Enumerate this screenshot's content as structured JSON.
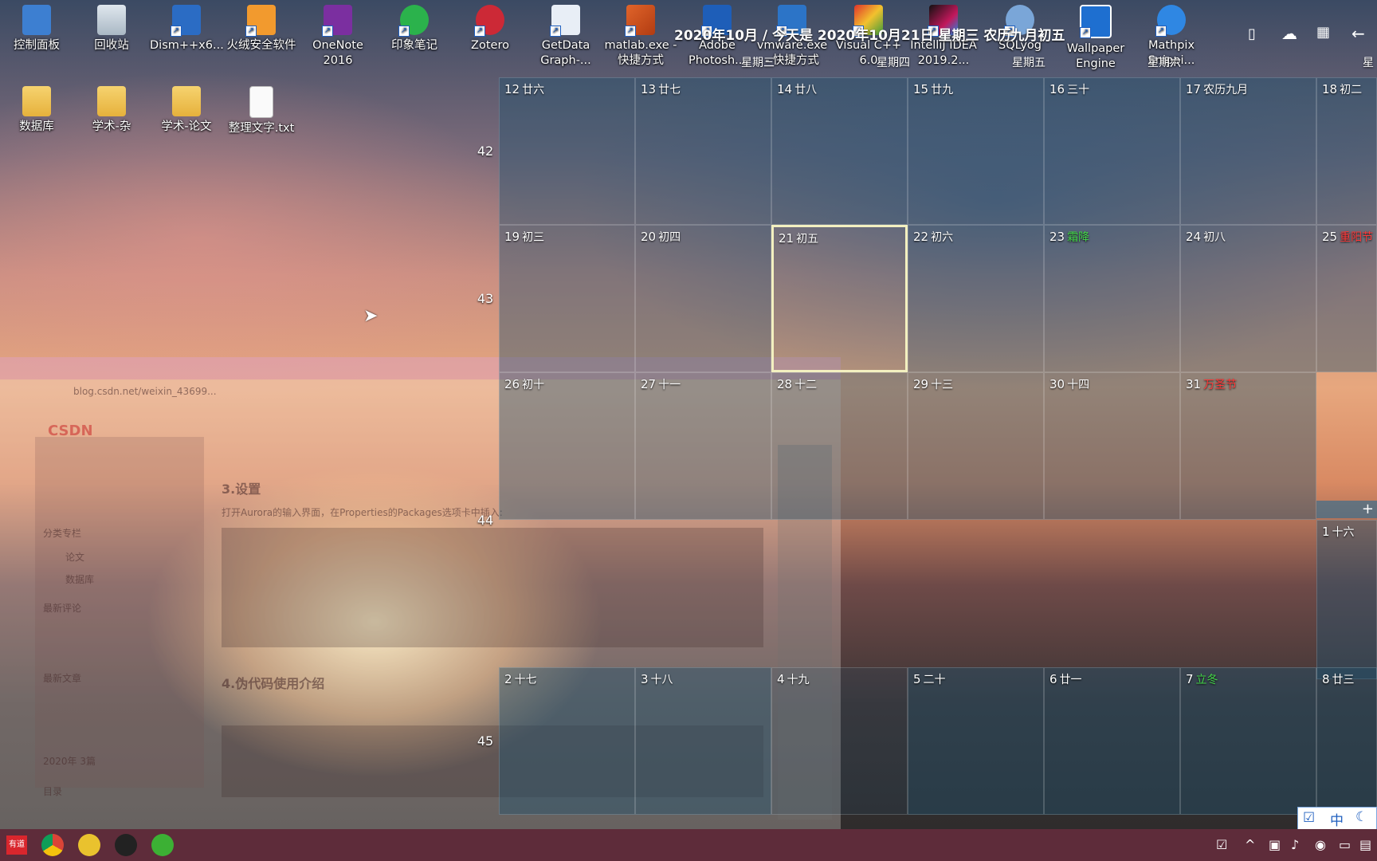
{
  "desktop_icons": [
    {
      "label": "控制面板",
      "icon": "control-panel-icon"
    },
    {
      "label": "回收站",
      "icon": "recycle-bin-icon"
    },
    {
      "label": "Dism++x6...",
      "icon": "dism-icon"
    },
    {
      "label": "火绒安全软件",
      "icon": "huorong-icon"
    },
    {
      "label": "OneNote 2016",
      "icon": "onenote-icon"
    },
    {
      "label": "印象笔记",
      "icon": "evernote-icon"
    },
    {
      "label": "Zotero",
      "icon": "zotero-icon"
    },
    {
      "label": "GetData Graph-...",
      "icon": "getdata-icon"
    },
    {
      "label": "matlab.exe - 快捷方式",
      "icon": "matlab-icon"
    },
    {
      "label": "Adobe Photosh...",
      "icon": "photoshop-icon"
    },
    {
      "label": "vmware.exe - 快捷方式",
      "icon": "vmware-icon"
    },
    {
      "label": "Visual C++ 6.0",
      "icon": "visual-cpp-icon"
    },
    {
      "label": "IntelliJ IDEA 2019.2...",
      "icon": "intellij-icon"
    },
    {
      "label": "SQLyog",
      "icon": "sqlyog-icon"
    },
    {
      "label": "Wallpaper Engine",
      "icon": "wallpaper-engine-icon"
    },
    {
      "label": "Mathpix Snippi...",
      "icon": "mathpix-icon"
    },
    {
      "label": "数据库",
      "icon": "folder-icon"
    },
    {
      "label": "学术-杂",
      "icon": "folder-icon"
    },
    {
      "label": "学术-论文",
      "icon": "folder-icon"
    },
    {
      "label": "整理文字.txt",
      "icon": "text-file-icon"
    }
  ],
  "calendar": {
    "title": "2020年10月 / 今天是 2020年10月21日 星期三 农历九月初五",
    "weekday_headers": [
      "星期三",
      "星期四",
      "星期五",
      "星期六",
      "星"
    ],
    "week_numbers": [
      "42",
      "43",
      "44",
      "45"
    ],
    "weeks": [
      [
        {
          "day": "12",
          "lunar": "廿六"
        },
        {
          "day": "13",
          "lunar": "廿七"
        },
        {
          "day": "14",
          "lunar": "廿八"
        },
        {
          "day": "15",
          "lunar": "廿九"
        },
        {
          "day": "16",
          "lunar": "三十"
        },
        {
          "day": "17",
          "lunar": "农历九月"
        },
        {
          "day": "18",
          "lunar": "初二"
        }
      ],
      [
        {
          "day": "19",
          "lunar": "初三"
        },
        {
          "day": "20",
          "lunar": "初四"
        },
        {
          "day": "21",
          "lunar": "初五"
        },
        {
          "day": "22",
          "lunar": "初六"
        },
        {
          "day": "23",
          "lunar": "霜降"
        },
        {
          "day": "24",
          "lunar": "初八"
        },
        {
          "day": "25",
          "lunar": "重阳节"
        }
      ],
      [
        {
          "day": "26",
          "lunar": "初十"
        },
        {
          "day": "27",
          "lunar": "十一"
        },
        {
          "day": "28",
          "lunar": "十二"
        },
        {
          "day": "29",
          "lunar": "十三"
        },
        {
          "day": "30",
          "lunar": "十四"
        },
        {
          "day": "31",
          "lunar": "万圣节"
        },
        {
          "day": "1",
          "lunar": "十六"
        }
      ],
      [
        {
          "day": "2",
          "lunar": "十七"
        },
        {
          "day": "3",
          "lunar": "十八"
        },
        {
          "day": "4",
          "lunar": "十九"
        },
        {
          "day": "5",
          "lunar": "二十"
        },
        {
          "day": "6",
          "lunar": "廿一"
        },
        {
          "day": "7",
          "lunar": "立冬"
        },
        {
          "day": "8",
          "lunar": "廿三"
        }
      ]
    ],
    "add_button": "+",
    "today_color": "#f3f0c0",
    "holiday_color": "#ff3a3a",
    "solar_term_color": "#45d64a"
  },
  "browser": {
    "logo": "CSDN",
    "url": "blog.csdn.net/weixin_43699...",
    "heading_settings": "3.设置",
    "text_settings": "打开Aurora的输入界面，在Properties的Packages选项卡中插入:",
    "heading_pseudocode": "4.伪代码使用介绍",
    "sidebar_items": [
      "分类专栏",
      "论文",
      "数据库",
      "最新评论",
      "最新文章",
      "2020年 3篇",
      "目录"
    ]
  },
  "taskbar": {
    "apps": [
      "youdao-icon",
      "chrome-icon",
      "app-icon",
      "qq-icon",
      "wechat-icon"
    ],
    "youdao_label": "有道",
    "ime_label": "中"
  }
}
